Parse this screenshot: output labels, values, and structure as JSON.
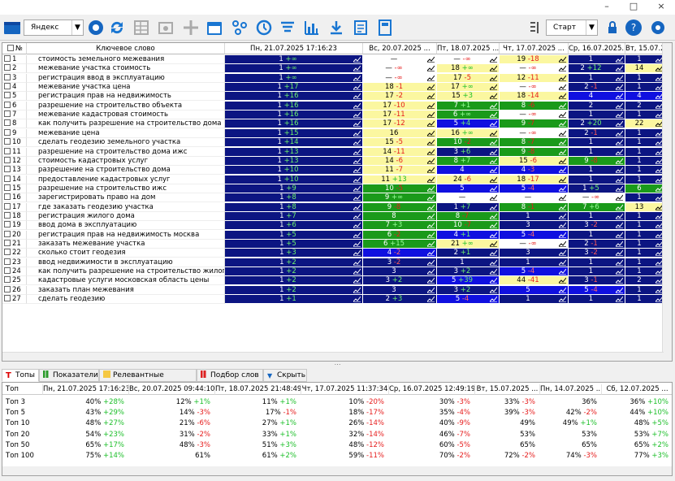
{
  "window": {
    "minimize": "–",
    "maximize": "□",
    "close": "×"
  },
  "toolbar": {
    "search_engine": "Яндекс",
    "start_label": "Старт"
  },
  "grid": {
    "header_num": "№",
    "header_keyword": "Ключевое слово",
    "columns": [
      "Пн, 21.07.2025 17:16:23",
      "Вс, 20.07.2025 ...",
      "Пт, 18.07.2025 ...",
      "Чт, 17.07.2025 ...",
      "Ср, 16.07.2025...",
      "Вт, 15.07.2..."
    ],
    "rows": [
      {
        "n": "1",
        "kw": "стоимость земельного межевания",
        "c": [
          [
            "1",
            "+∞",
            "b1"
          ],
          [
            "—",
            "",
            "b5"
          ],
          [
            "—",
            "-∞",
            "b5"
          ],
          [
            "19",
            "-18",
            "b4"
          ],
          [
            "1",
            "",
            "b1"
          ],
          [
            "1",
            "",
            "b1"
          ]
        ]
      },
      {
        "n": "2",
        "kw": "межевание участка стоимость",
        "c": [
          [
            "1",
            "+∞",
            "b1"
          ],
          [
            "—",
            "-∞",
            "b5"
          ],
          [
            "18",
            "+∞",
            "b4"
          ],
          [
            "—",
            "-∞",
            "b5"
          ],
          [
            "2",
            "+12",
            "b1"
          ],
          [
            "14",
            "",
            "b4"
          ]
        ]
      },
      {
        "n": "3",
        "kw": "регистрация ввод в эксплуатацию",
        "c": [
          [
            "1",
            "+∞",
            "b1"
          ],
          [
            "—",
            "-∞",
            "b5"
          ],
          [
            "17",
            "-5",
            "b4"
          ],
          [
            "12",
            "-11",
            "b4"
          ],
          [
            "1",
            "",
            "b1"
          ],
          [
            "1",
            "",
            "b1"
          ]
        ]
      },
      {
        "n": "4",
        "kw": "межевание участка цена",
        "c": [
          [
            "1",
            "+17",
            "b1"
          ],
          [
            "18",
            "-1",
            "b4"
          ],
          [
            "17",
            "+∞",
            "b4"
          ],
          [
            "—",
            "-∞",
            "b5"
          ],
          [
            "2",
            "-1",
            "b1"
          ],
          [
            "1",
            "",
            "b1"
          ]
        ]
      },
      {
        "n": "5",
        "kw": "регистрация прав на недвижимость",
        "c": [
          [
            "1",
            "+16",
            "b1"
          ],
          [
            "17",
            "-2",
            "b4"
          ],
          [
            "15",
            "+3",
            "b4"
          ],
          [
            "18",
            "-14",
            "b4"
          ],
          [
            "4",
            "",
            "b2"
          ],
          [
            "4",
            "",
            "b2"
          ]
        ]
      },
      {
        "n": "6",
        "kw": "разрешение на строительство объекта",
        "c": [
          [
            "1",
            "+16",
            "b1"
          ],
          [
            "17",
            "-10",
            "b4"
          ],
          [
            "7",
            "+1",
            "b3"
          ],
          [
            "8",
            "-6",
            "b3"
          ],
          [
            "2",
            "",
            "b1"
          ],
          [
            "2",
            "",
            "b1"
          ]
        ]
      },
      {
        "n": "7",
        "kw": "межевание кадастровая стоимость",
        "c": [
          [
            "1",
            "+16",
            "b1"
          ],
          [
            "17",
            "-11",
            "b4"
          ],
          [
            "6",
            "+∞",
            "b3"
          ],
          [
            "—",
            "-∞",
            "b5"
          ],
          [
            "1",
            "",
            "b1"
          ],
          [
            "1",
            "",
            "b1"
          ]
        ]
      },
      {
        "n": "8",
        "kw": "как получить разрешение на строительство дома",
        "c": [
          [
            "1",
            "+16",
            "b1"
          ],
          [
            "17",
            "-12",
            "b4"
          ],
          [
            "5",
            "+4",
            "b2"
          ],
          [
            "9",
            "-7",
            "b3"
          ],
          [
            "2",
            "+20",
            "b1"
          ],
          [
            "22",
            "",
            "b4"
          ]
        ]
      },
      {
        "n": "9",
        "kw": "межевание цена",
        "c": [
          [
            "1",
            "+15",
            "b1"
          ],
          [
            "16",
            "",
            "b4"
          ],
          [
            "16",
            "+∞",
            "b4"
          ],
          [
            "—",
            "-∞",
            "b5"
          ],
          [
            "2",
            "-1",
            "b1"
          ],
          [
            "1",
            "",
            "b1"
          ]
        ]
      },
      {
        "n": "10",
        "kw": "сделать геодезию земельного участка",
        "c": [
          [
            "1",
            "+14",
            "b1"
          ],
          [
            "15",
            "-5",
            "b4"
          ],
          [
            "10",
            "-2",
            "b3"
          ],
          [
            "8",
            "-7",
            "b3"
          ],
          [
            "1",
            "",
            "b1"
          ],
          [
            "1",
            "",
            "b1"
          ]
        ]
      },
      {
        "n": "11",
        "kw": "разрешение на строительство дома ижс",
        "c": [
          [
            "1",
            "+13",
            "b1"
          ],
          [
            "14",
            "-11",
            "b4"
          ],
          [
            "3",
            "+6",
            "b1"
          ],
          [
            "9",
            "-8",
            "b3"
          ],
          [
            "1",
            "",
            "b1"
          ],
          [
            "1",
            "",
            "b1"
          ]
        ]
      },
      {
        "n": "12",
        "kw": "стоимость кадастровых услуг",
        "c": [
          [
            "1",
            "+13",
            "b1"
          ],
          [
            "14",
            "-6",
            "b4"
          ],
          [
            "8",
            "+7",
            "b3"
          ],
          [
            "15",
            "-6",
            "b4"
          ],
          [
            "9",
            "-8",
            "b3"
          ],
          [
            "1",
            "",
            "b1"
          ]
        ]
      },
      {
        "n": "13",
        "kw": "разрешение на строительство дома",
        "c": [
          [
            "1",
            "+10",
            "b1"
          ],
          [
            "11",
            "-7",
            "b4"
          ],
          [
            "4",
            "",
            "b2"
          ],
          [
            "4",
            "-3",
            "b2"
          ],
          [
            "1",
            "",
            "b1"
          ],
          [
            "1",
            "",
            "b1"
          ]
        ]
      },
      {
        "n": "14",
        "kw": "предоставление кадастровых услуг",
        "c": [
          [
            "1",
            "+10",
            "b1"
          ],
          [
            "11",
            "+13",
            "b4"
          ],
          [
            "24",
            "-6",
            "b4"
          ],
          [
            "18",
            "-17",
            "b4"
          ],
          [
            "1",
            "",
            "b1"
          ],
          [
            "1",
            "",
            "b1"
          ]
        ]
      },
      {
        "n": "15",
        "kw": "разрешение на строительство ижс",
        "c": [
          [
            "1",
            "+9",
            "b1"
          ],
          [
            "10",
            "-5",
            "b3"
          ],
          [
            "5",
            "",
            "b2"
          ],
          [
            "5",
            "-4",
            "b2"
          ],
          [
            "1",
            "+5",
            "b1"
          ],
          [
            "6",
            "",
            "b3"
          ]
        ]
      },
      {
        "n": "16",
        "kw": "зарегистрировать право на дом",
        "c": [
          [
            "1",
            "+8",
            "b1"
          ],
          [
            "9",
            "+∞",
            "b3"
          ],
          [
            "—",
            "",
            "b5"
          ],
          [
            "—",
            "",
            "b5"
          ],
          [
            "—",
            "-∞",
            "b5"
          ],
          [
            "1",
            "",
            "b1"
          ]
        ]
      },
      {
        "n": "17",
        "kw": "где заказать геодезию участка",
        "c": [
          [
            "1",
            "+8",
            "b1"
          ],
          [
            "9",
            "-8",
            "b3"
          ],
          [
            "1",
            "+7",
            "b1"
          ],
          [
            "8",
            "-1",
            "b3"
          ],
          [
            "7",
            "+6",
            "b3"
          ],
          [
            "13",
            "",
            "b4"
          ]
        ]
      },
      {
        "n": "18",
        "kw": "регистрация жилого дома",
        "c": [
          [
            "1",
            "+7",
            "b1"
          ],
          [
            "8",
            "",
            "b3"
          ],
          [
            "8",
            "-7",
            "b3"
          ],
          [
            "1",
            "",
            "b1"
          ],
          [
            "1",
            "",
            "b1"
          ],
          [
            "1",
            "",
            "b1"
          ]
        ]
      },
      {
        "n": "19",
        "kw": "ввод дома в эксплуатацию",
        "c": [
          [
            "1",
            "+6",
            "b1"
          ],
          [
            "7",
            "+3",
            "b3"
          ],
          [
            "10",
            "-7",
            "b3"
          ],
          [
            "3",
            "",
            "b1"
          ],
          [
            "3",
            "-2",
            "b1"
          ],
          [
            "1",
            "",
            "b1"
          ]
        ]
      },
      {
        "n": "20",
        "kw": "регистрация прав на недвижимость москва",
        "c": [
          [
            "1",
            "+5",
            "b1"
          ],
          [
            "6",
            "-2",
            "b3"
          ],
          [
            "4",
            "+1",
            "b2"
          ],
          [
            "5",
            "-4",
            "b2"
          ],
          [
            "1",
            "",
            "b1"
          ],
          [
            "1",
            "",
            "b1"
          ]
        ]
      },
      {
        "n": "21",
        "kw": "заказать межевание участка",
        "c": [
          [
            "1",
            "+5",
            "b1"
          ],
          [
            "6",
            "+15",
            "b3"
          ],
          [
            "21",
            "+∞",
            "b4"
          ],
          [
            "—",
            "-∞",
            "b5"
          ],
          [
            "2",
            "-1",
            "b1"
          ],
          [
            "1",
            "",
            "b1"
          ]
        ]
      },
      {
        "n": "22",
        "kw": "сколько стоит геодезия",
        "c": [
          [
            "1",
            "+3",
            "b1"
          ],
          [
            "4",
            "-2",
            "b2"
          ],
          [
            "2",
            "+1",
            "b1"
          ],
          [
            "3",
            "",
            "b1"
          ],
          [
            "3",
            "-2",
            "b1"
          ],
          [
            "1",
            "",
            "b1"
          ]
        ]
      },
      {
        "n": "23",
        "kw": "ввод недвижимости в эксплуатацию",
        "c": [
          [
            "1",
            "+2",
            "b1"
          ],
          [
            "3",
            "-2",
            "b1"
          ],
          [
            "1",
            "",
            "b1"
          ],
          [
            "1",
            "",
            "b1"
          ],
          [
            "1",
            "",
            "b1"
          ],
          [
            "1",
            "",
            "b1"
          ]
        ]
      },
      {
        "n": "24",
        "kw": "как получить разрешение на строительство жилог...",
        "c": [
          [
            "1",
            "+2",
            "b1"
          ],
          [
            "3",
            "",
            "b1"
          ],
          [
            "3",
            "+2",
            "b1"
          ],
          [
            "5",
            "-4",
            "b2"
          ],
          [
            "1",
            "",
            "b1"
          ],
          [
            "1",
            "",
            "b1"
          ]
        ]
      },
      {
        "n": "25",
        "kw": "кадастровые услуги московская область цены",
        "c": [
          [
            "1",
            "+2",
            "b1"
          ],
          [
            "3",
            "+2",
            "b1"
          ],
          [
            "5",
            "+39",
            "b2"
          ],
          [
            "44",
            "-41",
            "b4"
          ],
          [
            "3",
            "-1",
            "b1"
          ],
          [
            "2",
            "",
            "b1"
          ]
        ]
      },
      {
        "n": "26",
        "kw": "заказать план межевания",
        "c": [
          [
            "1",
            "+2",
            "b1"
          ],
          [
            "3",
            "",
            "b1"
          ],
          [
            "3",
            "+2",
            "b1"
          ],
          [
            "5",
            "",
            "b2"
          ],
          [
            "5",
            "-4",
            "b2"
          ],
          [
            "1",
            "",
            "b1"
          ]
        ]
      },
      {
        "n": "27",
        "kw": "сделать геодезию",
        "c": [
          [
            "1",
            "+1",
            "b1"
          ],
          [
            "2",
            "+3",
            "b1"
          ],
          [
            "5",
            "-4",
            "b2"
          ],
          [
            "1",
            "",
            "b1"
          ],
          [
            "1",
            "",
            "b1"
          ],
          [
            "1",
            "",
            "b1"
          ]
        ]
      }
    ]
  },
  "tabs": [
    "Топы",
    "Показатели",
    "Релевантные страницы",
    "Подбор слов",
    "Скрыть"
  ],
  "bottom": {
    "header": [
      "Топ",
      "Пн, 21.07.2025 17:16:23",
      "Вс, 20.07.2025 09:44:10",
      "Пт, 18.07.2025 21:48:49",
      "Чт, 17.07.2025 11:37:34",
      "Ср, 16.07.2025 12:49:19",
      "Вт, 15.07.2025 ...",
      "Пн, 14.07.2025 ...",
      "Сб, 12.07.2025 ..."
    ],
    "rows": [
      {
        "t": "Топ 3",
        "c": [
          [
            "40%",
            "+28%"
          ],
          [
            "12%",
            "+1%"
          ],
          [
            "11%",
            "+1%"
          ],
          [
            "10%",
            "-20%"
          ],
          [
            "30%",
            "-3%"
          ],
          [
            "33%",
            "-3%"
          ],
          [
            "36%",
            ""
          ],
          [
            "36%",
            "+10%"
          ]
        ]
      },
      {
        "t": "Топ 5",
        "c": [
          [
            "43%",
            "+29%"
          ],
          [
            "14%",
            "-3%"
          ],
          [
            "17%",
            "-1%"
          ],
          [
            "18%",
            "-17%"
          ],
          [
            "35%",
            "-4%"
          ],
          [
            "39%",
            "-3%"
          ],
          [
            "42%",
            "-2%"
          ],
          [
            "44%",
            "+10%"
          ]
        ]
      },
      {
        "t": "Топ 10",
        "c": [
          [
            "48%",
            "+27%"
          ],
          [
            "21%",
            "-6%"
          ],
          [
            "27%",
            "+1%"
          ],
          [
            "26%",
            "-14%"
          ],
          [
            "40%",
            "-9%"
          ],
          [
            "49%",
            ""
          ],
          [
            "49%",
            "+1%"
          ],
          [
            "48%",
            "+5%"
          ]
        ]
      },
      {
        "t": "Топ 20",
        "c": [
          [
            "54%",
            "+23%"
          ],
          [
            "31%",
            "-2%"
          ],
          [
            "33%",
            "+1%"
          ],
          [
            "32%",
            "-14%"
          ],
          [
            "46%",
            "-7%"
          ],
          [
            "53%",
            ""
          ],
          [
            "53%",
            ""
          ],
          [
            "53%",
            "+7%"
          ]
        ]
      },
      {
        "t": "Топ 50",
        "c": [
          [
            "65%",
            "+17%"
          ],
          [
            "48%",
            "-3%"
          ],
          [
            "51%",
            "+3%"
          ],
          [
            "48%",
            "-12%"
          ],
          [
            "60%",
            "-5%"
          ],
          [
            "65%",
            ""
          ],
          [
            "65%",
            ""
          ],
          [
            "65%",
            "+2%"
          ]
        ]
      },
      {
        "t": "Топ 100",
        "c": [
          [
            "75%",
            "+14%"
          ],
          [
            "61%",
            ""
          ],
          [
            "61%",
            "+2%"
          ],
          [
            "59%",
            "-11%"
          ],
          [
            "70%",
            "-2%"
          ],
          [
            "72%",
            "-2%"
          ],
          [
            "74%",
            "-3%"
          ],
          [
            "77%",
            "+3%"
          ]
        ]
      }
    ]
  }
}
